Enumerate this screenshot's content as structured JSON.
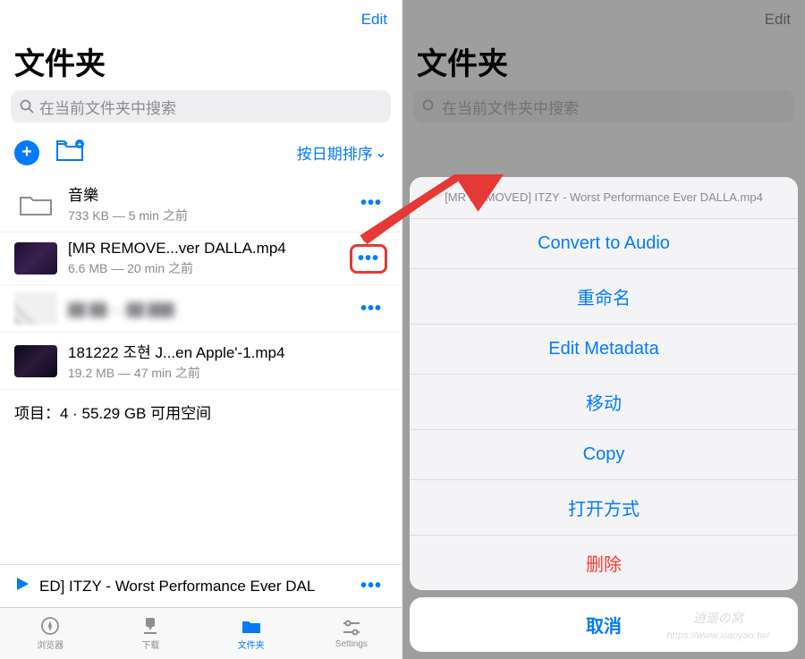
{
  "left": {
    "edit": "Edit",
    "title": "文件夹",
    "search_placeholder": "在当前文件夹中搜索",
    "sort": "按日期排序",
    "files": [
      {
        "name": "音樂",
        "sub": "733 KB — 5 min 之前",
        "kind": "folder"
      },
      {
        "name": "[MR REMOVE...ver  DALLA.mp4",
        "sub": "6.6 MB — 20 min 之前",
        "kind": "vid",
        "highlight": true
      },
      {
        "name": " ",
        "sub": "blurred",
        "kind": "vid2"
      },
      {
        "name": "181222 조현 J...en Apple'-1.mp4",
        "sub": "19.2 MB — 47 min 之前",
        "kind": "vid3"
      }
    ],
    "summary": "项目：4 · 55.29 GB 可用空间",
    "nowplaying": "ED] ITZY - Worst Performance Ever  DAL",
    "tabs": [
      {
        "label": "浏览器",
        "icon": "compass"
      },
      {
        "label": "下载",
        "icon": "download"
      },
      {
        "label": "文件夹",
        "icon": "folder",
        "active": true
      },
      {
        "label": "Settings",
        "icon": "sliders"
      }
    ]
  },
  "right": {
    "edit": "Edit",
    "title": "文件夹",
    "sheet_title": "[MR REMOVED] ITZY - Worst Performance Ever DALLA.mp4",
    "actions": [
      {
        "label": "Convert to Audio"
      },
      {
        "label": "重命名"
      },
      {
        "label": "Edit Metadata"
      },
      {
        "label": "移动"
      },
      {
        "label": "Copy"
      },
      {
        "label": "打开方式"
      },
      {
        "label": "删除",
        "danger": true
      }
    ],
    "cancel": "取消"
  }
}
